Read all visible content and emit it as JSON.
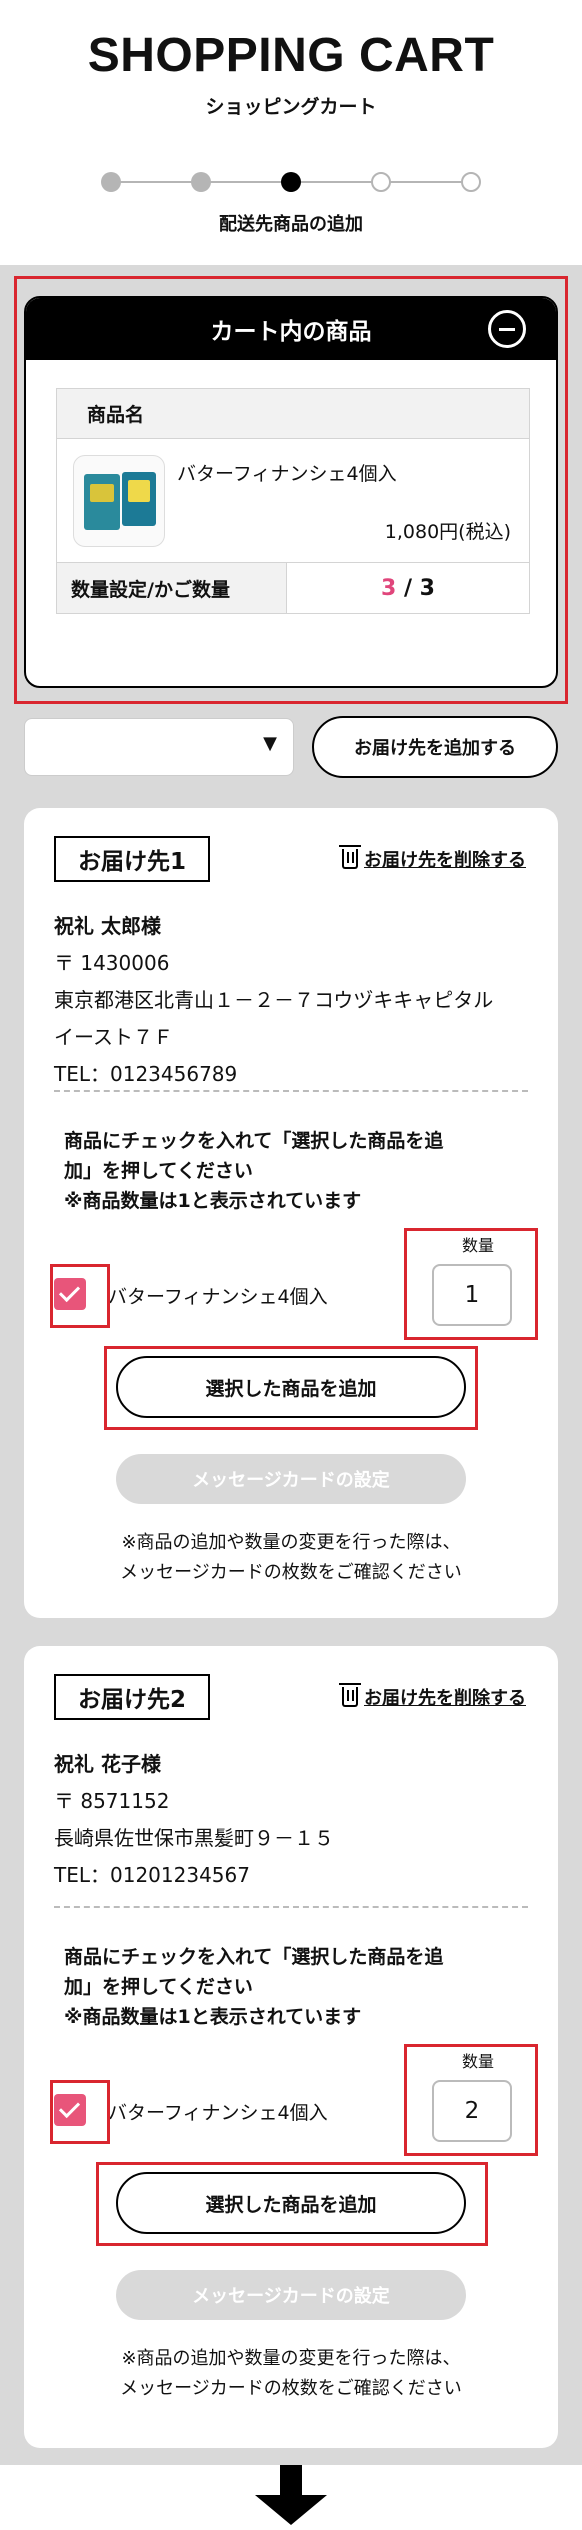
{
  "header": {
    "title": "SHOPPING CART",
    "subtitle": "ショッピングカート",
    "step_label": "配送先商品の追加",
    "steps_total": 5,
    "current_step": 3
  },
  "cart": {
    "panel_title": "カート内の商品",
    "column_header": "商品名",
    "product_name": "バターフィナンシェ4個入",
    "price": "1,080円(税込)",
    "qty_label": "数量設定/かご数量",
    "qty_assigned": "3",
    "qty_separator": " / ",
    "qty_total": "3"
  },
  "address_select": {
    "value": "",
    "arrow": "▼"
  },
  "add_destination_label": "お届け先を追加する",
  "destinations": [
    {
      "tag": "お届け先1",
      "delete_label": "お届け先を削除する",
      "name": "祝礼 太郎様",
      "postal": "〒 1430006",
      "address1": "東京都港区北青山１－２－７コウヅキキャピタル",
      "address2": "イースト７Ｆ",
      "tel": "TEL：0123456789",
      "instruction1": "商品にチェックを入れて「選択した商品を追",
      "instruction2": "加」を押してください",
      "instruction3": "※商品数量は1と表示されています",
      "item_name": "バターフィナンシェ4個入",
      "checked": true,
      "qty_header": "数量",
      "qty": "1",
      "add_selected_label": "選択した商品を追加",
      "message_card_label": "メッセージカードの設定",
      "note1": "※商品の追加や数量の変更を行った際は、",
      "note2": "メッセージカードの枚数をご確認ください"
    },
    {
      "tag": "お届け先2",
      "delete_label": "お届け先を削除する",
      "name": "祝礼 花子様",
      "postal": "〒 8571152",
      "address1": "長崎県佐世保市黒髪町９－１５",
      "tel": "TEL：01201234567",
      "instruction1": "商品にチェックを入れて「選択した商品を追",
      "instruction2": "加」を押してください",
      "instruction3": "※商品数量は1と表示されています",
      "item_name": "バターフィナンシェ4個入",
      "checked": true,
      "qty_header": "数量",
      "qty": "2",
      "add_selected_label": "選択した商品を追加",
      "message_card_label": "メッセージカードの設定",
      "note1": "※商品の追加や数量の変更を行った際は、",
      "note2": "メッセージカードの枚数をご確認ください"
    }
  ],
  "colors": {
    "highlight": "#d9262f",
    "checkbox": "#e8557a",
    "qty_accent": "#e0457b",
    "gray_bg": "#d9d9d9"
  }
}
